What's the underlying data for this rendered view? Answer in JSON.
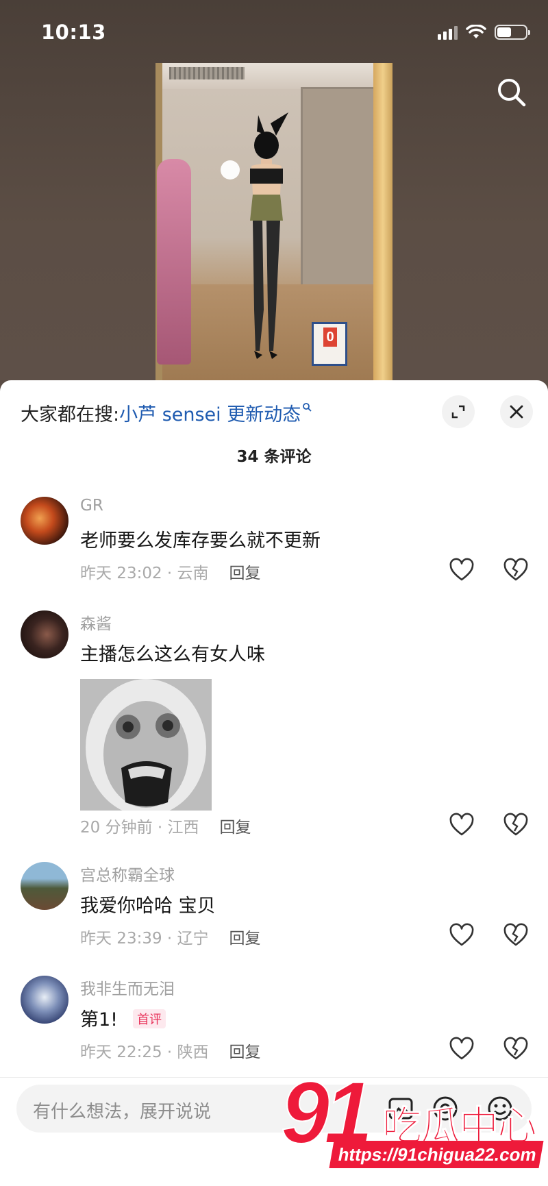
{
  "status_bar": {
    "time": "10:13"
  },
  "sheet": {
    "hot_search_prefix": "大家都在搜:",
    "hot_search_keyword": "小芦 sensei 更新动态",
    "comment_count": "34 条评论"
  },
  "comments": [
    {
      "user": "GR",
      "text": "老师要么发库存要么就不更新",
      "meta": "昨天 23:02 · 云南",
      "reply": "回复"
    },
    {
      "user": "森酱",
      "text": "主播怎么这么有女人味",
      "meta": "20 分钟前 · 江西",
      "reply": "回复"
    },
    {
      "user": "宫总称霸全球",
      "text": "我爱你哈哈  宝贝",
      "meta": "昨天 23:39 · 辽宁",
      "reply": "回复"
    },
    {
      "user": "我非生而无泪",
      "text": "第1!",
      "badge": "首评",
      "meta": "昨天 22:25 · 陕西",
      "reply": "回复"
    }
  ],
  "input": {
    "placeholder": "有什么想法，展开说说"
  },
  "watermark": {
    "number": "91",
    "text": "吃瓜中心",
    "url": "https://91chigua22.com"
  },
  "icons": [
    "search-icon",
    "expand-icon",
    "close-icon",
    "heart-icon",
    "broken-heart-icon",
    "image-icon",
    "at-icon",
    "emoji-icon"
  ]
}
